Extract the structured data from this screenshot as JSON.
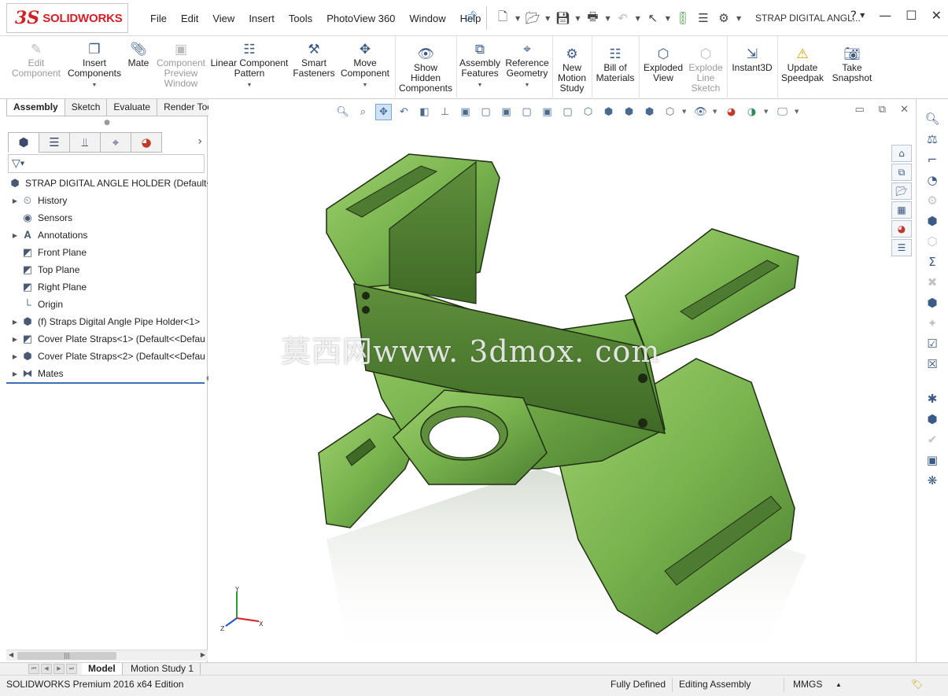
{
  "app": {
    "logo_mark": "3S",
    "logo_text": "SOLIDWORKS",
    "document_title": "STRAP DIGITAL ANGL...",
    "help_icon": "?"
  },
  "menu": [
    "File",
    "Edit",
    "View",
    "Insert",
    "Tools",
    "PhotoView 360",
    "Window",
    "Help"
  ],
  "ribbon": {
    "edit_component": "Edit\nComponent",
    "insert_components": "Insert\nComponents",
    "mate": "Mate",
    "component_preview": "Component\nPreview\nWindow",
    "linear_pattern": "Linear Component\nPattern",
    "smart_fasteners": "Smart\nFasteners",
    "move_component": "Move\nComponent",
    "show_hidden": "Show\nHidden\nComponents",
    "assembly_features": "Assembly\nFeatures",
    "reference_geometry": "Reference\nGeometry",
    "new_motion_study": "New\nMotion\nStudy",
    "bill_of_materials": "Bill of\nMaterials",
    "exploded_view": "Exploded\nView",
    "explode_line_sketch": "Explode\nLine\nSketch",
    "instant3d": "Instant3D",
    "update_speedpak": "Update\nSpeedpak",
    "take_snapshot": "Take\nSnapshot"
  },
  "command_tabs": [
    "Assembly",
    "Sketch",
    "Evaluate",
    "Render Tools"
  ],
  "tree": {
    "root": "STRAP DIGITAL ANGLE HOLDER  (Default<D",
    "items": [
      {
        "label": "History",
        "icon": "history-icon",
        "expand": true
      },
      {
        "label": "Sensors",
        "icon": "sensors-icon",
        "expand": false
      },
      {
        "label": "Annotations",
        "icon": "annotations-icon",
        "expand": true
      },
      {
        "label": "Front Plane",
        "icon": "plane-icon",
        "expand": false
      },
      {
        "label": "Top Plane",
        "icon": "plane-icon",
        "expand": false
      },
      {
        "label": "Right Plane",
        "icon": "plane-icon",
        "expand": false
      },
      {
        "label": "Origin",
        "icon": "origin-icon",
        "expand": false
      },
      {
        "label": "(f) Straps Digital Angle Pipe Holder<1>",
        "icon": "part-icon",
        "expand": true
      },
      {
        "label": "Cover Plate Straps<1> (Default<<Defau",
        "icon": "plane-icon",
        "expand": true
      },
      {
        "label": "Cover Plate Straps<2> (Default<<Defau",
        "icon": "part-icon",
        "expand": true
      },
      {
        "label": "Mates",
        "icon": "mates-icon",
        "expand": true
      }
    ]
  },
  "graphics": {
    "watermark": "莫西网www. 3dmox. com",
    "triad": {
      "x": "X",
      "y": "Y",
      "z": "Z"
    },
    "model_color": "#78b34e"
  },
  "bottom_tabs": [
    "Model",
    "Motion Study 1"
  ],
  "status": {
    "edition": "SOLIDWORKS Premium 2016 x64 Edition",
    "state": "Fully Defined",
    "mode": "Editing Assembly",
    "units": "MMGS"
  }
}
